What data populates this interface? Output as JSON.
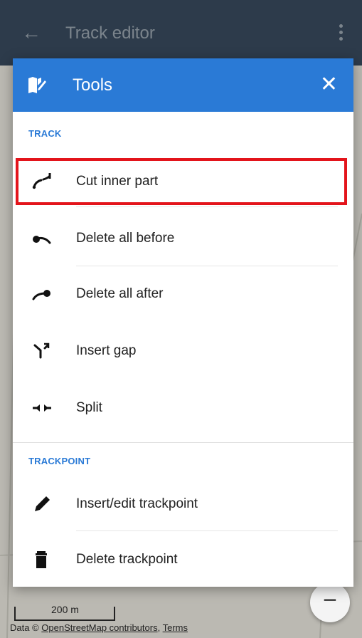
{
  "appbar": {
    "title": "Track editor"
  },
  "dialog": {
    "title": "Tools",
    "sections": [
      {
        "label": "TRACK"
      },
      {
        "label": "TRACKPOINT"
      }
    ],
    "items": [
      {
        "label": "Cut inner part",
        "icon": "cut-inner-part-icon"
      },
      {
        "label": "Delete all before",
        "icon": "delete-before-icon"
      },
      {
        "label": "Delete all after",
        "icon": "delete-after-icon"
      },
      {
        "label": "Insert gap",
        "icon": "insert-gap-icon"
      },
      {
        "label": "Split",
        "icon": "split-icon"
      },
      {
        "label": "Insert/edit trackpoint",
        "icon": "pencil-icon"
      },
      {
        "label": "Delete trackpoint",
        "icon": "trash-icon"
      }
    ]
  },
  "map": {
    "scale_label": "200 m",
    "attribution": {
      "prefix": "Data ©",
      "link1": "OpenStreetMap contributors",
      "sep": ",",
      "link2": "Terms"
    },
    "zoom_out_label": "−"
  },
  "colors": {
    "accent": "#2a7ad6",
    "highlight": "#e3141b",
    "appbar": "#37495c"
  }
}
